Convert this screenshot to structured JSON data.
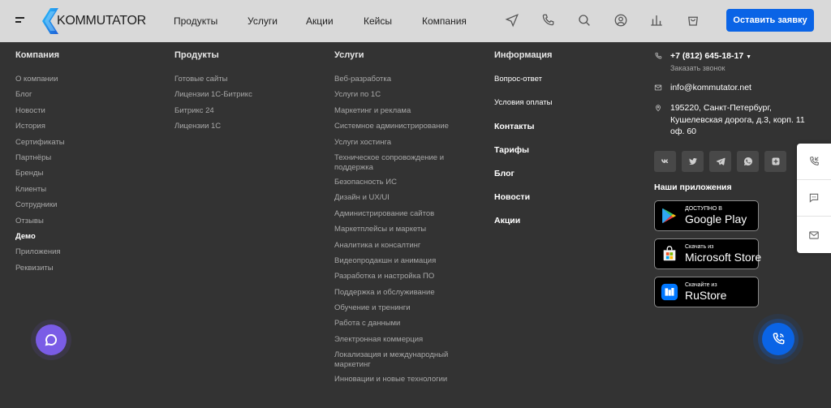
{
  "header": {
    "logo_text": "KOMMUTATOR",
    "nav": [
      "Продукты",
      "Услуги",
      "Акции",
      "Кейсы",
      "Компания"
    ],
    "cta_label": "Оставить заявку"
  },
  "columns": {
    "company": {
      "title": "Компания",
      "items": [
        "О компании",
        "Блог",
        "Новости",
        "История",
        "Сертификаты",
        "Партнёры",
        "Бренды",
        "Клиенты",
        "Сотрудники",
        "Отзывы",
        "Демо",
        "Приложения",
        "Реквизиты"
      ],
      "active": "Демо"
    },
    "products": {
      "title": "Продукты",
      "items": [
        "Готовые сайты",
        "Лицензии 1С-Битрикс",
        "Битрикс 24",
        "Лицензии 1С"
      ]
    },
    "services": {
      "title": "Услуги",
      "items": [
        "Веб-разработка",
        "Услуги по 1С",
        "Маркетинг и реклама",
        "Системное администрирование",
        "Услуги хостинга",
        "Техническое сопровождение и поддержка",
        "Безопасность ИС",
        "Дизайн и UX/UI",
        "Администрирование сайтов",
        "Маркетплейсы и маркеты",
        "Аналитика и консалтинг",
        "Видеопродакшн и анимация",
        "Разработка и настройка ПО",
        "Поддержка и обслуживание",
        "Обучение и тренинги",
        "Работа с данными",
        "Электронная коммерция",
        "Локализация и международный маркетинг",
        "Инновации и новые технологии"
      ]
    },
    "info": {
      "title": "Информация",
      "items": [
        "Вопрос-ответ",
        "Условия оплаты",
        "Контакты",
        "Тарифы",
        "Блог",
        "Новости",
        "Акции"
      ]
    }
  },
  "contacts": {
    "phone": "+7 (812) 645-18-17",
    "callback": "Заказать звонок",
    "email": "info@kommutator.net",
    "address_line1": "195220, Санкт-Петербург,",
    "address_line2": "Кушелевская дорога, д.3, корп. 11",
    "address_line3": "оф. 60"
  },
  "socials": [
    "vk-icon",
    "twitter-icon",
    "telegram-icon",
    "whatsapp-icon",
    "plus-square-icon"
  ],
  "apps": {
    "title": "Наши приложения",
    "google": {
      "small": "ДОСТУПНО В",
      "big": "Google Play"
    },
    "microsoft": {
      "small": "Скачать из",
      "big": "Microsoft Store"
    },
    "rustore": {
      "small": "Скачайте из",
      "big": "RuStore"
    }
  },
  "colors": {
    "accent": "#0a64e6",
    "chat": "#7a5ce6",
    "footer_bg": "#333333",
    "header_bg": "#d9d9d9"
  }
}
